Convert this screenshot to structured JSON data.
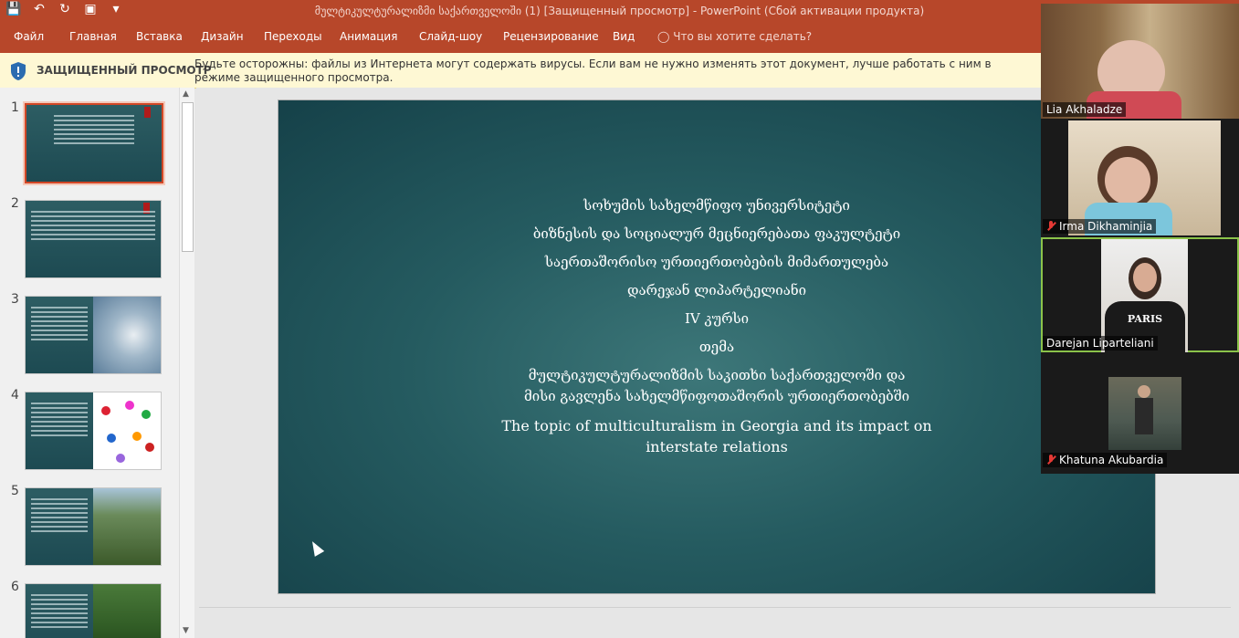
{
  "window": {
    "title": "მულტიკულტურალიზმი საქართველოში (1) [Защищенный просмотр] - PowerPoint (Сбой активации продукта)"
  },
  "qat": {
    "icons": [
      "save-icon",
      "undo-icon",
      "redo-icon",
      "present-icon",
      "customize-icon"
    ]
  },
  "ribbon": {
    "tabs": [
      "Файл",
      "Главная",
      "Вставка",
      "Дизайн",
      "Переходы",
      "Анимация",
      "Слайд-шоу",
      "Рецензирование",
      "Вид"
    ],
    "tell_me": "Что вы хотите сделать?"
  },
  "protected_view": {
    "label": "ЗАЩИЩЕННЫЙ ПРОСМОТР",
    "message": "Будьте осторожны: файлы из Интернета могут содержать вирусы. Если вам не нужно изменять этот документ, лучше работать с ним в режиме защищенного просмотра."
  },
  "thumbnails": [
    {
      "number": "1"
    },
    {
      "number": "2"
    },
    {
      "number": "3"
    },
    {
      "number": "4"
    },
    {
      "number": "5"
    },
    {
      "number": "6"
    }
  ],
  "slide": {
    "lines": [
      "სოხუმის სახელმწიფო უნივერსიტეტი",
      "ბიზნესის და სოციალურ მეცნიერებათა ფაკულტეტი",
      "საერთაშორისო ურთიერთობების მიმართულება",
      "დარეჯან ლიპარტელიანი",
      "IV კურსი",
      "თემა",
      "მულტიკულტურალიზმის   საკითხი საქართველოში და",
      "მისი გავლენა სახელმწიფოთაშორის ურთიერთობებში"
    ],
    "english_line1": "The topic of multiculturalism in Georgia and its impact on",
    "english_line2": "interstate relations"
  },
  "participants": [
    {
      "name": "Lia Akhaladze",
      "muted": false
    },
    {
      "name": "Irma Dikhaminjia",
      "muted": true
    },
    {
      "name": "Darejan Liparteliani",
      "muted": false
    },
    {
      "name": "Khatuna Akubardia",
      "muted": true
    }
  ]
}
